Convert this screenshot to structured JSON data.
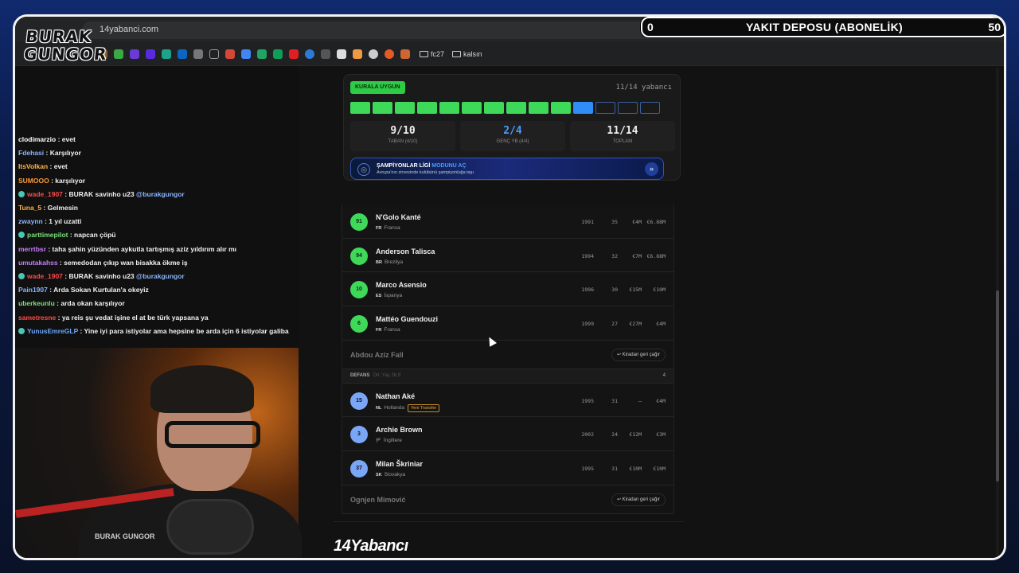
{
  "browser": {
    "url": "14yabanci.com",
    "bookmarks": [
      "fc27",
      "kalsın"
    ]
  },
  "overlay": {
    "logo": "BURAK GUNGOR",
    "hud_left": "0",
    "hud_title": "YAKIT DEPOSU (ABONELİK)",
    "hud_right": "50",
    "cam_watermark": "BURAK GUNGOR"
  },
  "chat": [
    {
      "user": "clodimarzio",
      "text": "evet",
      "color": "#ffffff"
    },
    {
      "user": "Fdehasi",
      "text": "Karşılıyor",
      "color": "#8ab4ff"
    },
    {
      "user": "ItsVolkan",
      "text": "evet",
      "color": "#ffb347"
    },
    {
      "user": "SUMOOO",
      "text": "karşılıyor",
      "color": "#ff9a3a"
    },
    {
      "user": "wade_1907",
      "text": "BURAK savinho u23",
      "mention": "@burakgungor",
      "color": "#ff4a4a",
      "badge": true
    },
    {
      "user": "Tuna_5",
      "text": "Gelmesin",
      "color": "#ffb347"
    },
    {
      "user": "zwaynn",
      "text": "1 yıl uzatti",
      "color": "#8ab4ff"
    },
    {
      "user": "parttimepilot",
      "text": "napcan çöpü",
      "color": "#7be07b",
      "badge": true
    },
    {
      "user": "merrtbsr",
      "text": "taha şahin yüzünden aykutla tartışmış aziz yıldırım alır mı",
      "color": "#c77dff"
    },
    {
      "user": "umutakahss",
      "text": "semedodan çıkıp wan bisakka ökme iş",
      "color": "#c77dff"
    },
    {
      "user": "wade_1907",
      "text": "BURAK savinho u23",
      "mention": "@burakgungor",
      "color": "#ff4a4a",
      "badge": true
    },
    {
      "user": "Pain1907",
      "text": "Arda Sokan Kurtulan'a okeyiz",
      "color": "#8ab4ff"
    },
    {
      "user": "uberkeunlu",
      "text": "arda okan karşılıyor",
      "color": "#7be07b"
    },
    {
      "user": "sametresne",
      "text": "ya reis şu vedat işine el at be türk yapsana ya",
      "color": "#ff4a4a"
    },
    {
      "user": "YunusEmreGLP",
      "text": "Yine iyi para istiyolar ama hepsine be arda için 6 istiyolar galiba",
      "color": "#6aa8ff",
      "badge": true
    }
  ],
  "panel": {
    "status_badge": "KURALA UYGUN",
    "count_text": "11/14 yabancı",
    "slots": [
      "g",
      "g",
      "g",
      "g",
      "g",
      "g",
      "g",
      "g",
      "g",
      "g",
      "b",
      "e",
      "e",
      "e"
    ],
    "stats": [
      {
        "value": "9/10",
        "label": "TABAN (4/10)",
        "color": "white"
      },
      {
        "value": "2/4",
        "label": "GENÇ YB (4/4)",
        "color": "blue"
      },
      {
        "value": "11/14",
        "label": "TOPLAM",
        "color": "white"
      }
    ],
    "cl_title_a": "ŞAMPİYONLAR LİGİ",
    "cl_title_b": "MODUNU AÇ",
    "cl_sub": "Avrupa'nın zirvesinde kulübünü şampiyonluğa taşı"
  },
  "players_mid": [
    {
      "num": "91",
      "name": "N'Golo Kanté",
      "code": "FR",
      "country": "Fransa",
      "year": "1991",
      "age": "35",
      "v1": "€4M",
      "v2": "€6.88M"
    },
    {
      "num": "94",
      "name": "Anderson Talisca",
      "code": "BR",
      "country": "Brezilya",
      "year": "1994",
      "age": "32",
      "v1": "€7M",
      "v2": "€6.88M"
    },
    {
      "num": "10",
      "name": "Marco Asensio",
      "code": "ES",
      "country": "İspanya",
      "year": "1996",
      "age": "30",
      "v1": "€15M",
      "v2": "€10M"
    },
    {
      "num": "6",
      "name": "Mattéo Guendouzi",
      "code": "FR",
      "country": "Fransa",
      "year": "1999",
      "age": "27",
      "v1": "€27M",
      "v2": "€4M"
    }
  ],
  "loan1": {
    "name": "Abdou Aziz Fall",
    "button": "↩ Kiradan geri çağır"
  },
  "section": {
    "title": "DEFANS",
    "sub": "Ort. Yaş 26.9",
    "count": "4"
  },
  "players_def": [
    {
      "num": "15",
      "name": "Nathan Aké",
      "code": "NL",
      "country": "Hollanda",
      "tag": "Yeni Transfer",
      "year": "1995",
      "age": "31",
      "v1": "–",
      "v2": "€4M"
    },
    {
      "num": "3",
      "name": "Archie Brown",
      "code": "🏴",
      "country": "İngiltere",
      "year": "2002",
      "age": "24",
      "v1": "€12M",
      "v2": "€3M"
    },
    {
      "num": "37",
      "name": "Milan Škriniar",
      "code": "SK",
      "country": "Slovakya",
      "year": "1995",
      "age": "31",
      "v1": "€10M",
      "v2": "€10M"
    }
  ],
  "loan2": {
    "name": "Ognjen Mimović",
    "button": "↩ Kiradan geri çağır"
  },
  "footer": {
    "brand": "14Yabancı"
  },
  "colors": {
    "green": "#3fd95a",
    "blue": "#2f8df5",
    "accent": "#4a9bff"
  }
}
